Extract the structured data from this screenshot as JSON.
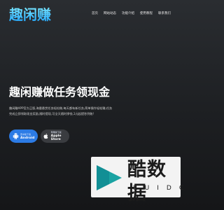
{
  "header": {
    "logo_text": "趣闲赚",
    "nav": [
      "首页",
      "网站动态",
      "功能介绍",
      "使用教程",
      "联系我们"
    ]
  },
  "hero": {
    "title": "趣闲赚做任务领现金",
    "description": "趣闲赚APP官方正版,海量悬赏任务轻松做,每天都有新任务,简单操作轻松赚,任务完成立即领取现金奖励,随时提现,可全天随时挣钱,1元起提秒到账!"
  },
  "downloads": {
    "android": {
      "small": "安卓版下载",
      "label": "Android"
    },
    "apple": {
      "small": "苹果版下载",
      "label": "Apple Store"
    }
  },
  "watermark": {
    "cn": "酷数据",
    "en": "KUIDC"
  },
  "colors": {
    "logo_gradient_top": "#7ce8ff",
    "logo_gradient_bottom": "#1fa6ff",
    "android_button": "#2c7be5",
    "apple_button": "#3a3c40",
    "play_icon_teal": "#1aa3a3"
  }
}
